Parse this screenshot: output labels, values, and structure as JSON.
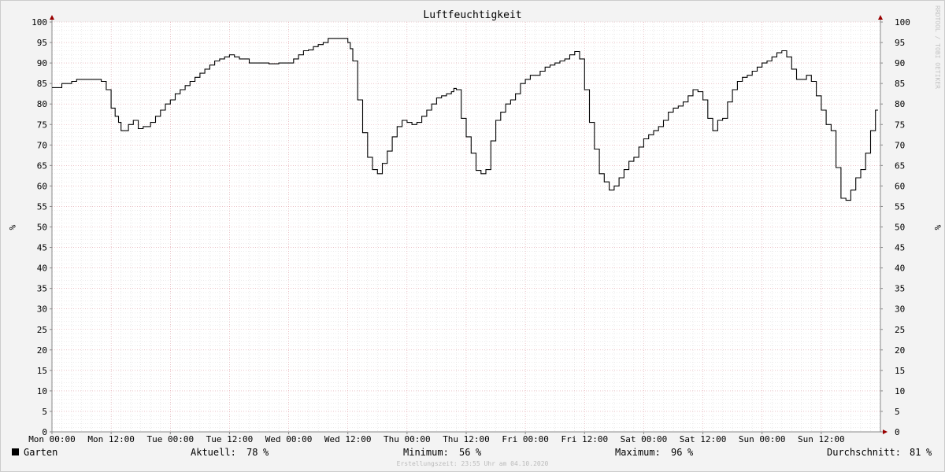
{
  "chart_data": {
    "type": "line",
    "title": "Luftfeuchtigkeit",
    "ylabel": "%",
    "ylim": [
      0,
      100
    ],
    "yticks": [
      0,
      5,
      10,
      15,
      20,
      25,
      30,
      35,
      40,
      45,
      50,
      55,
      60,
      65,
      70,
      75,
      80,
      85,
      90,
      95,
      100
    ],
    "xlim": [
      0,
      168
    ],
    "xunit": "hours",
    "xticks": [
      {
        "value": 0,
        "label": "Mon 00:00"
      },
      {
        "value": 12,
        "label": "Mon 12:00"
      },
      {
        "value": 24,
        "label": "Tue 00:00"
      },
      {
        "value": 36,
        "label": "Tue 12:00"
      },
      {
        "value": 48,
        "label": "Wed 00:00"
      },
      {
        "value": 60,
        "label": "Wed 12:00"
      },
      {
        "value": 72,
        "label": "Thu 00:00"
      },
      {
        "value": 84,
        "label": "Thu 12:00"
      },
      {
        "value": 96,
        "label": "Fri 00:00"
      },
      {
        "value": 108,
        "label": "Fri 12:00"
      },
      {
        "value": 120,
        "label": "Sat 00:00"
      },
      {
        "value": 132,
        "label": "Sat 12:00"
      },
      {
        "value": 144,
        "label": "Sun 00:00"
      },
      {
        "value": 156,
        "label": "Sun 12:00"
      }
    ],
    "grid": true,
    "series": [
      {
        "name": "Garten",
        "color": "#000000",
        "step": true,
        "x": [
          0,
          2,
          4,
          5,
          6,
          8,
          10,
          11,
          12,
          12.8,
          13.5,
          14,
          15.5,
          16.5,
          17.5,
          18.5,
          20,
          21,
          22,
          23,
          24,
          25,
          26,
          27,
          28,
          29,
          30,
          31,
          32,
          33,
          34,
          35,
          36,
          37,
          38,
          39,
          40,
          42,
          44,
          46,
          47,
          48,
          49,
          50,
          51,
          52,
          53,
          54,
          55,
          56,
          57,
          58,
          59,
          60,
          60.5,
          61,
          62,
          63,
          64,
          65,
          66,
          67,
          68,
          69,
          70,
          71,
          72,
          73,
          74,
          75,
          76,
          77,
          78,
          79,
          80,
          81,
          81.5,
          82,
          83,
          84,
          85,
          86,
          87,
          88,
          89,
          90,
          91,
          92,
          93,
          94,
          95,
          96,
          97,
          98,
          99,
          100,
          101,
          102,
          103,
          104,
          105,
          106,
          107,
          108,
          109,
          110,
          111,
          112,
          113,
          114,
          115,
          116,
          117,
          118,
          119,
          120,
          121,
          122,
          123,
          124,
          125,
          126,
          127,
          128,
          129,
          130,
          131,
          132,
          133,
          134,
          135,
          136,
          137,
          138,
          139,
          140,
          141,
          142,
          143,
          144,
          145,
          146,
          147,
          148,
          149,
          150,
          151,
          152,
          153,
          154,
          155,
          156,
          157,
          158,
          159,
          160,
          161,
          162,
          163,
          164,
          165,
          166,
          167
        ],
        "values": [
          84,
          85,
          85.5,
          86,
          86,
          86,
          85.5,
          83.5,
          79,
          77,
          75.5,
          73.5,
          75,
          76,
          74,
          74.5,
          75.5,
          77,
          78.5,
          80,
          81,
          82.5,
          83.5,
          84.5,
          85.5,
          86.5,
          87.5,
          88.5,
          89.5,
          90.5,
          91,
          91.5,
          92,
          91.5,
          91,
          91,
          90,
          90,
          89.8,
          90,
          90,
          90,
          91,
          92,
          93,
          93.2,
          94,
          94.5,
          95,
          96,
          96,
          96,
          96,
          95,
          93.5,
          90.5,
          81,
          73,
          67,
          64,
          63,
          65.5,
          68.5,
          72,
          74.5,
          76,
          75.5,
          75,
          75.5,
          77,
          78.5,
          80,
          81.5,
          82,
          82.5,
          83,
          83.8,
          83.5,
          76.5,
          72,
          68,
          63.8,
          63,
          64,
          71,
          76,
          78,
          80,
          81,
          82.5,
          85,
          86,
          87,
          87,
          88,
          89,
          89.5,
          90,
          90.5,
          91,
          92,
          92.8,
          91,
          83.5,
          75.5,
          69,
          63,
          61,
          59,
          60,
          62,
          64,
          66,
          67,
          69.5,
          71.5,
          72.5,
          73.5,
          74.5,
          76,
          78,
          79,
          79.5,
          80.5,
          82,
          83.5,
          83,
          81,
          76.5,
          73.5,
          76,
          76.5,
          80.5,
          83.5,
          85.5,
          86.5,
          87,
          88,
          89,
          90,
          90.5,
          91.5,
          92.5,
          93,
          91.5,
          88.5,
          86,
          86,
          87,
          85.5,
          82,
          78.5,
          75,
          73.5,
          64.5,
          57,
          56.5,
          59,
          62,
          64,
          68,
          73.5,
          78.5
        ]
      }
    ],
    "legend": {
      "placement": "bottom-left",
      "series_name": "Garten",
      "stats": [
        {
          "label": "Aktuell:",
          "value": "78",
          "unit": "%"
        },
        {
          "label": "Minimum:",
          "value": "56",
          "unit": "%"
        },
        {
          "label": "Maximum:",
          "value": "96",
          "unit": "%"
        },
        {
          "label": "Durchschnitt:",
          "value": "81",
          "unit": "%"
        }
      ]
    },
    "footer": "Erstellungszeit: 23:55 Uhr am 04.10.2020",
    "watermark": "RRDTOOL / TOBI OETIKER"
  }
}
